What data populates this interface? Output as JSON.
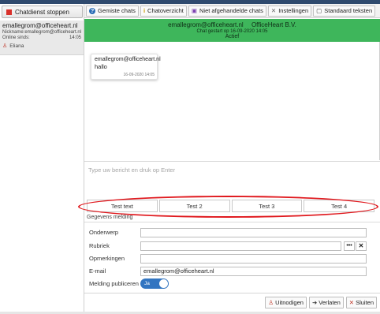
{
  "sidebar": {
    "stop_button_label": "Chatdienst stoppen",
    "chat": {
      "email": "emallegrom@officeheart.nl",
      "nickname_label": "Nickname:",
      "nickname_value": "emallegrom@officeheart.nl",
      "online_label": "Online sinds:",
      "online_value": "14:05",
      "user": "Eliana"
    }
  },
  "tabs": [
    {
      "label": "Gemiste chats",
      "icon": "question-icon"
    },
    {
      "label": "Chatoverzicht",
      "icon": "info-icon"
    },
    {
      "label": "Niet afgehandelde chats",
      "icon": "lock-icon"
    },
    {
      "label": "Instellingen",
      "icon": "tools-icon"
    },
    {
      "label": "Standaard teksten",
      "icon": "message-icon"
    }
  ],
  "chat_header": {
    "email": "emallegrom@officeheart.nl",
    "company": "OfficeHeart B.V.",
    "started": "Chat gestart op 16-09-2020 14:05",
    "status": "Actief"
  },
  "messages": [
    {
      "from": "emallegrom@officeheart.nl",
      "text": "hallo",
      "time": "16-09-2020 14:05"
    }
  ],
  "composer": {
    "placeholder": "Type uw bericht en druk op Enter"
  },
  "quick_texts": [
    "Test text",
    "Test 2",
    "Test 3",
    "Test 4"
  ],
  "form": {
    "title": "Gegevens melding",
    "fields": {
      "onderwerp_label": "Onderwerp",
      "onderwerp_value": "",
      "rubriek_label": "Rubriek",
      "rubriek_value": "",
      "opmerkingen_label": "Opmerkingen",
      "opmerkingen_value": "",
      "email_label": "E-mail",
      "email_value": "emallegrom@officeheart.nl",
      "publiceren_label": "Melding publiceren",
      "publiceren_toggle_label": "Ja"
    },
    "dots_label": "•••",
    "clear_label": "✕"
  },
  "footer": {
    "invite_label": "Uitnodigen",
    "leave_label": "Verlaten",
    "close_label": "Sluiten"
  },
  "colors": {
    "header_green": "#3eb65b",
    "highlight_red": "#e0191e",
    "toggle_blue": "#3275c1",
    "stop_red": "#d9312b"
  }
}
